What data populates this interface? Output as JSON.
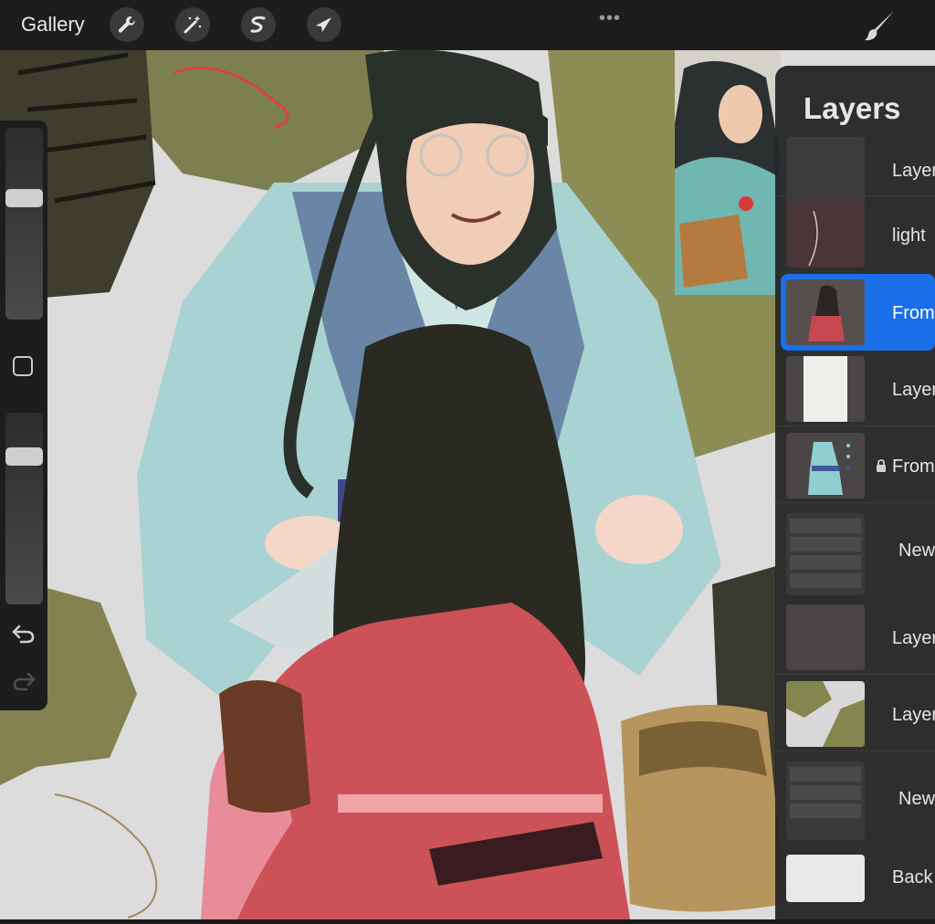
{
  "topbar": {
    "gallery_label": "Gallery",
    "more_label": "•••",
    "tools": [
      "wrench-icon",
      "magic-wand-icon",
      "selection-icon",
      "transform-arrow-icon"
    ],
    "brush_icon": "brush-icon"
  },
  "sidebar": {
    "undo_icon": "undo-icon",
    "redo_icon": "redo-icon",
    "brush_size_level": 0.65,
    "opacity_level": 0.8
  },
  "layers": {
    "title": "Layers",
    "items": [
      {
        "label": "Layer",
        "selected": false,
        "locked": false
      },
      {
        "label": "light",
        "selected": false,
        "locked": false
      },
      {
        "label": "From",
        "selected": true,
        "locked": false
      },
      {
        "label": "Layer",
        "selected": false,
        "locked": false
      },
      {
        "label": "From",
        "selected": false,
        "locked": true
      },
      {
        "label": "New",
        "selected": false,
        "locked": false
      },
      {
        "label": "Layer",
        "selected": false,
        "locked": false
      },
      {
        "label": "Layer",
        "selected": false,
        "locked": false
      },
      {
        "label": "New",
        "selected": false,
        "locked": false
      },
      {
        "label": "Back",
        "selected": false,
        "locked": false
      }
    ]
  },
  "colors": {
    "accent": "#1a6ee8",
    "panel": "#262628",
    "bar": "#1d1d1f"
  }
}
